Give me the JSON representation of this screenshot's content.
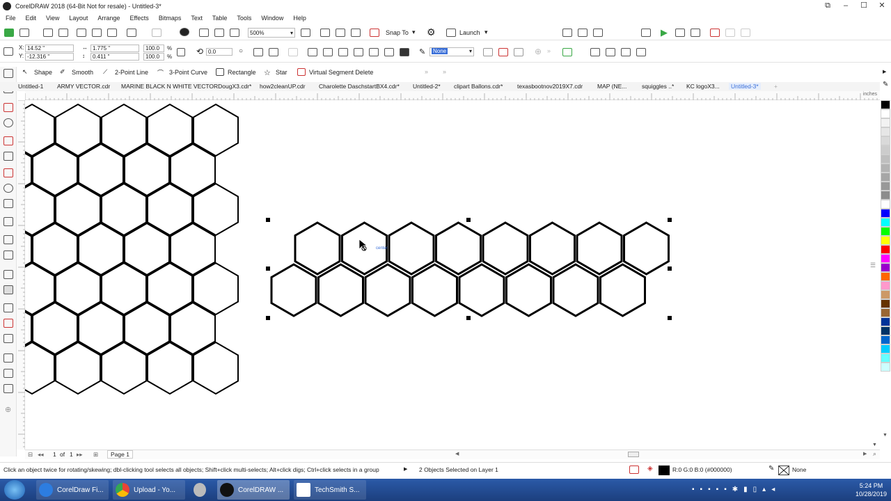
{
  "window": {
    "title": "CorelDRAW 2018 (64-Bit Not for resale) - Untitled-3*"
  },
  "menu": [
    "File",
    "Edit",
    "View",
    "Layout",
    "Arrange",
    "Effects",
    "Bitmaps",
    "Text",
    "Table",
    "Tools",
    "Window",
    "Help"
  ],
  "standard_toolbar": {
    "zoom": "500%",
    "snap_to": "Snap To",
    "launch": "Launch"
  },
  "property_bar": {
    "x": "14.52 \"",
    "y": "-12.316 \"",
    "width": "1.775 \"",
    "height": "0.411 \"",
    "scale_x": "100.0",
    "scale_y": "100.0",
    "pct": "%",
    "rotation": "0.0",
    "outline": "None"
  },
  "tool_props": {
    "shape": "Shape",
    "smooth": "Smooth",
    "two_point_line": "2-Point Line",
    "three_point_curve": "3-Point Curve",
    "rectangle": "Rectangle",
    "star": "Star",
    "virtual_segment_delete": "Virtual Segment Delete"
  },
  "doc_tabs": [
    "Untitled-1",
    "ARMY VECTOR.cdr",
    "MARINE BLACK N WHITE VECTORDougX3.cdr*",
    "how2cleanUP.cdr",
    "Charolette DaschstartBX4.cdr*",
    "Untitled-2*",
    "clipart Ballons.cdr*",
    "texasbootnov2019X7.cdr",
    "MAP (NE...",
    "squiggles ..*",
    "KC logoX3...",
    "Untitled-3*"
  ],
  "ruler_unit": "inches",
  "cursor_hint": "center",
  "page_nav": {
    "current": "1",
    "of": "of",
    "total": "1",
    "page_tab": "Page 1"
  },
  "status": {
    "hint": "Click an object twice for rotating/skewing; dbl-clicking tool selects all objects; Shift+click multi-selects; Alt+click digs; Ctrl+click selects in a group",
    "selection": "2 Objects Selected on Layer 1",
    "fill_info": "R:0 G:0 B:0 (#000000)",
    "outline_info": "None"
  },
  "taskbar": {
    "items": [
      "CorelDraw Fi...",
      "Upload - Yo...",
      "CorelDRAW ...",
      "TechSmith S..."
    ],
    "time": "5:24 PM",
    "date": "10/28/2019"
  },
  "palette": [
    "#000000",
    "#ffffff",
    "#f2f2f2",
    "#e6e6e6",
    "#d9d9d9",
    "#cccccc",
    "#bfbfbf",
    "#b3b3b3",
    "#a6a6a6",
    "#999999",
    "#8c8c8c",
    "#ffffff",
    "#0000ff",
    "#00ffff",
    "#00ff00",
    "#ffff00",
    "#ff0000",
    "#ff00ff",
    "#9900cc",
    "#ff6600",
    "#ff99cc",
    "#cc9966",
    "#663300",
    "#996633",
    "#003399",
    "#003366",
    "#0066cc",
    "#00ccff",
    "#66ffff",
    "#ccffff"
  ],
  "colors": {
    "accent": "#3a6fd8",
    "taskbar": "#1c3f7e",
    "selection_handle": "#000000"
  }
}
